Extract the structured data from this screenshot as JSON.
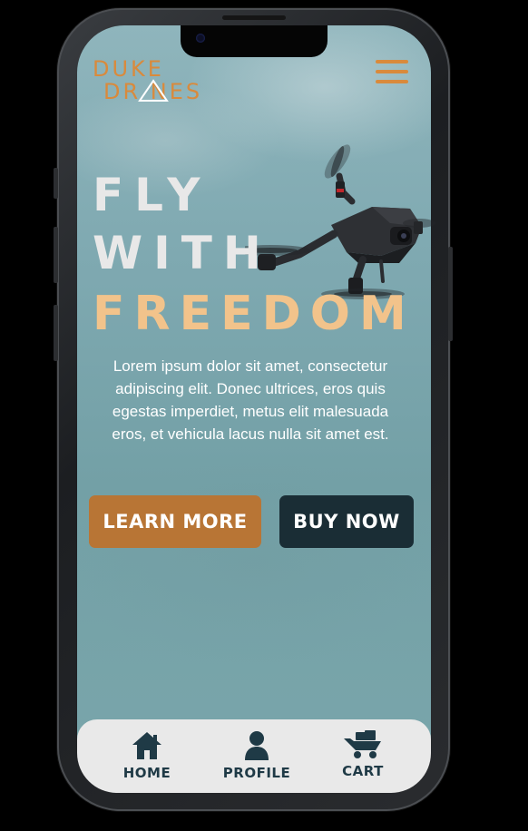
{
  "brand": {
    "logo_line1": "DUKE",
    "logo_line2": "DR NES"
  },
  "hero": {
    "line1": "FLY",
    "line2": "WITH",
    "line3": "FREEDOM",
    "description": "Lorem ipsum dolor sit amet, consectetur adipiscing elit. Donec ultrices, eros quis egestas imperdiet, metus elit malesuada eros, et vehicula lacus nulla sit amet est."
  },
  "actions": {
    "learn_more": "LEARN MORE",
    "buy_now": "BUY NOW"
  },
  "nav": {
    "items": [
      {
        "label": "HOME",
        "icon": "home-icon"
      },
      {
        "label": "PROFILE",
        "icon": "user-icon"
      },
      {
        "label": "CART",
        "icon": "cart-icon"
      }
    ]
  },
  "colors": {
    "brand_orange": "#d98a3c",
    "learn_more_bg": "#b87535",
    "buy_now_bg": "#1a2d35",
    "hero_accent": "#f2c38b",
    "nav_text": "#1f3a46",
    "nav_bg": "#e9e9e9"
  }
}
